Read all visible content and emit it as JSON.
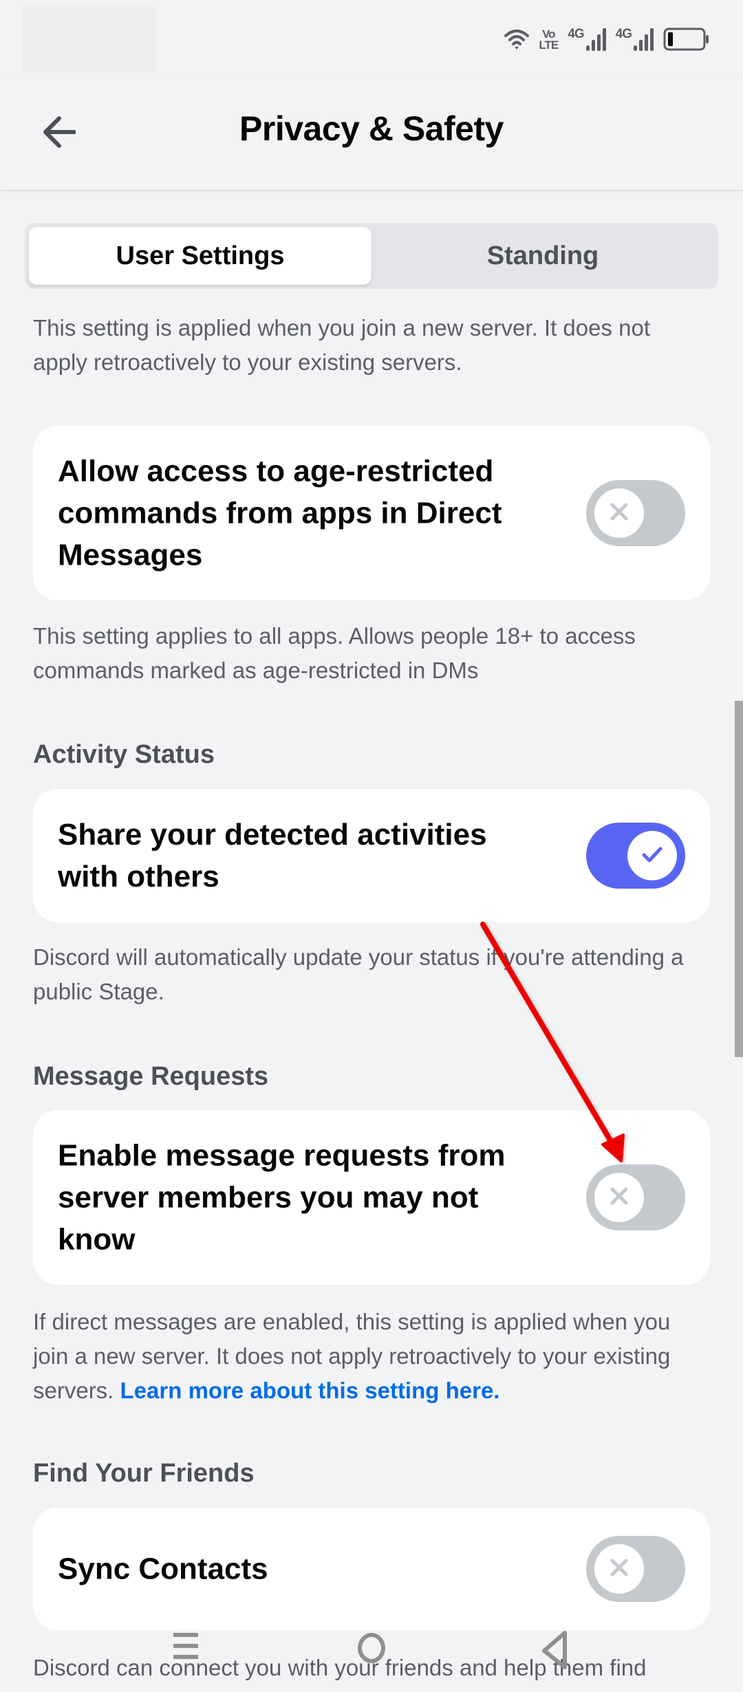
{
  "status_bar": {
    "icons": [
      "wifi-icon",
      "volte-icon",
      "signal-4g-sim1-icon",
      "signal-4g-sim2-icon",
      "battery-low-icon"
    ],
    "volte_top": "Vo",
    "volte_bottom": "LTE",
    "net1_label": "4G",
    "net2_label": "4G"
  },
  "header": {
    "back_icon": "arrow-left-icon",
    "title": "Privacy & Safety"
  },
  "tabs": [
    {
      "label": "User Settings",
      "active": true
    },
    {
      "label": "Standing",
      "active": false
    }
  ],
  "intro_description": "This setting is applied when you join a new server. It does not apply retroactively to your existing servers.",
  "settings": [
    {
      "section": null,
      "label": "Allow access to age-restricted commands from apps in Direct Messages",
      "enabled": false,
      "description": "This setting applies to all apps. Allows people 18+ to access commands marked as age-restricted in DMs"
    },
    {
      "section": "Activity Status",
      "label": "Share your detected activities with others",
      "enabled": true,
      "description": "Discord will automatically update your status if you're attending a public Stage."
    },
    {
      "section": "Message Requests",
      "label": "Enable message requests from server members you may not know",
      "enabled": false,
      "description": "If direct messages are enabled, this setting is applied when you join a new server. It does not apply retroactively to your existing servers.",
      "link": "Learn more about this setting here."
    },
    {
      "section": "Find Your Friends",
      "label": "Sync Contacts",
      "enabled": false,
      "description": "Discord can connect you with your friends and help them find"
    }
  ],
  "colors": {
    "background": "#f2f3f5",
    "card": "#ffffff",
    "toggle_on": "#5865f2",
    "toggle_off": "#c4c9ce",
    "link": "#006ce7",
    "annotation_arrow": "#ee0000"
  },
  "annotation": {
    "type": "red-arrow",
    "target": "message-requests-toggle"
  },
  "nav_bar": {
    "icons": [
      "recent-apps-icon",
      "home-icon",
      "back-triangle-icon"
    ]
  }
}
